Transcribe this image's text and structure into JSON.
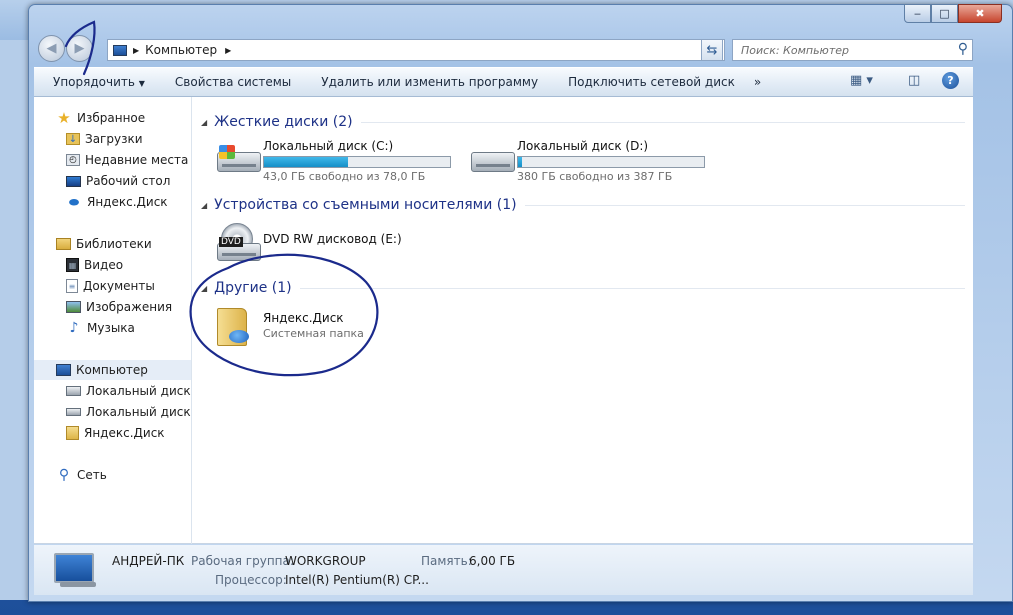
{
  "window": {
    "buttons": {
      "minimize": "‒",
      "maximize": "□",
      "close": "✖"
    }
  },
  "address": {
    "path": "Компьютер"
  },
  "search": {
    "placeholder": "Поиск: Компьютер"
  },
  "toolbar": {
    "organize": "Упорядочить",
    "properties": "Свойства системы",
    "uninstall": "Удалить или изменить программу",
    "map_drive": "Подключить сетевой диск",
    "more": "»",
    "help": "?"
  },
  "sidebar": {
    "favorites": "Избранное",
    "downloads": "Загрузки",
    "recent": "Недавние места",
    "desktop": "Рабочий стол",
    "yadisk_fav": "Яндекс.Диск",
    "libraries": "Библиотеки",
    "video": "Видео",
    "docs": "Документы",
    "images": "Изображения",
    "music": "Музыка",
    "computer": "Компьютер",
    "disk_c": "Локальный диск (C",
    "disk_d": "Локальный диск (D",
    "yadisk": "Яндекс.Диск",
    "network": "Сеть"
  },
  "groups": {
    "hdd": "Жесткие диски (2)",
    "removable": "Устройства со съемными носителями (1)",
    "other": "Другие (1)"
  },
  "drives": [
    {
      "name": "Локальный диск (C:)",
      "free": "43,0 ГБ свободно из 78,0 ГБ",
      "used_fraction": 0.45
    },
    {
      "name": "Локальный диск (D:)",
      "free": "380 ГБ свободно из 387 ГБ",
      "used_fraction": 0.02
    }
  ],
  "dvd": {
    "name": "DVD RW дисковод (E:)",
    "label": "DVD"
  },
  "yadisk_item": {
    "name": "Яндекс.Диск",
    "type": "Системная папка"
  },
  "details": {
    "pc_name": "АНДРЕЙ-ПК",
    "workgroup_label": "Рабочая группа:",
    "workgroup": "WORKGROUP",
    "memory_label": "Память:",
    "memory": "6,00 ГБ",
    "cpu_label": "Процессор:",
    "cpu": "Intel(R) Pentium(R) CP..."
  }
}
